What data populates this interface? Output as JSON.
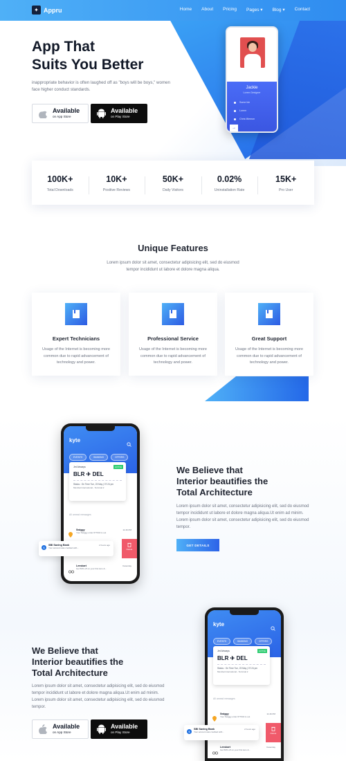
{
  "nav": {
    "logo": "Appru",
    "items": [
      "Home",
      "About",
      "Pricing",
      "Pages ▾",
      "Blog ▾",
      "Contact"
    ]
  },
  "hero": {
    "title_line1": "App That",
    "title_line2": "Suits You Better",
    "subtitle": "inappropriate behavior is often laughed off as \"boys will be boys,\" women face higher conduct standards.",
    "appstore": {
      "big": "Available",
      "small": "on App Store"
    },
    "playstore": {
      "big": "Available",
      "small": "on Play Store"
    },
    "phone": {
      "name": "Jackie",
      "role": "Lorem Designer",
      "rows": [
        "Some ble",
        "Lorem",
        "Chris Mlemon"
      ]
    }
  },
  "stats": [
    {
      "value": "100K+",
      "label": "Total Downloads"
    },
    {
      "value": "10K+",
      "label": "Positive Reviews"
    },
    {
      "value": "50K+",
      "label": "Daily Visitors"
    },
    {
      "value": "0.02%",
      "label": "Uninstallation Rate"
    },
    {
      "value": "15K+",
      "label": "Pro User"
    }
  ],
  "features": {
    "title": "Unique Features",
    "subtitle": "Lorem ipsum dolor sit amet, consectetur adipisicing elit, sed do eiusmod tempor incididunt ut labore et dolore magna aliqua.",
    "cards": [
      {
        "title": "Expert Technicians",
        "text": "Usage of the Internet is becoming more common due to rapid advancement of technology and power."
      },
      {
        "title": "Professional Service",
        "text": "Usage of the Internet is becoming more common due to rapid advancement of technology and power."
      },
      {
        "title": "Great Support",
        "text": "Usage of the Internet is becoming more common due to rapid advancement of technology and power."
      }
    ]
  },
  "app_screen": {
    "logo": "kyte",
    "chips": [
      "EVENTS",
      "BANKING",
      "OFFERS"
    ],
    "ticket": {
      "airline": "Jet Airways",
      "tag": "ACTIVE",
      "route": "BLR ✈ DEL",
      "status": "Status : On Time  Tue, 23 May | 07:24 pm",
      "number": "Mumbai International - Terminal 2"
    },
    "unread": "All unread messages",
    "msg1": {
      "title": "Swiggy",
      "text": "Your Swiggy order #77643 is out",
      "time": "11:46 PM"
    },
    "bank": {
      "title": "SBI Saving Bank",
      "text": "Your account was credited with...",
      "time": "2 hours ago"
    },
    "msg2": {
      "title": "Lenskart",
      "text": "Get 50% off on your first lens &...",
      "time": "Yesterday"
    },
    "delete": "Delete"
  },
  "block1": {
    "title_line1": "We Believe that",
    "title_line2": "Interior beautifies the",
    "title_line3": "Total Architecture",
    "text": "Lorem ipsum dolor sit amet, consectetur adipisicing elit, sed do eiusmod tempor incididunt ut labore et dolore magna aliqua.Ut enim ad minim. Lorem ipsum dolor sit amet, consectetur adipisicing elit, sed do eiusmod tempor.",
    "cta": "GET DETAILS"
  },
  "block2": {
    "title_line1": "We Believe that",
    "title_line2": "Interior beautifies the",
    "title_line3": "Total Architecture",
    "text": "Lorem ipsum dolor sit amet, consectetur adipisicing elit, sed do eiusmod tempor incididunt ut labore et dolore magna aliqua.Ut enim ad minim. Lorem ipsum dolor sit amet, consectetur adipisicing elit, sed do eiusmod tempor.",
    "appstore": {
      "big": "Available",
      "small": "on App Store"
    },
    "playstore": {
      "big": "Available",
      "small": "on Play Store"
    }
  },
  "colors": {
    "accent": "#2d63e8",
    "accent_light": "#4fb0f7",
    "dark": "#1f2430"
  },
  "icons": {
    "apple": "apple-icon",
    "android": "android-icon",
    "feature": "book-icon",
    "search": "search-icon"
  }
}
